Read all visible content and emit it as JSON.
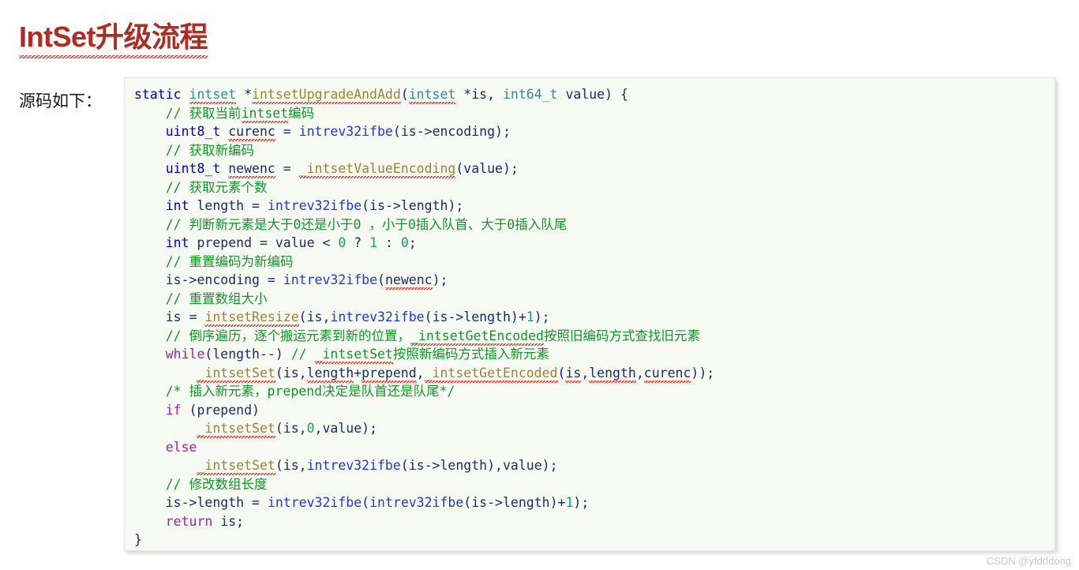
{
  "page": {
    "title": "IntSet升级流程",
    "source_label": "源码如下：",
    "watermark": "CSDN @yfdddong",
    "title_color": "#b02b22",
    "code_background": "#f7faf2",
    "spellcheck_underline_color": "#e03b30"
  },
  "code": {
    "language": "c",
    "lines": [
      "static intset *intsetUpgradeAndAdd(intset *is, int64_t value) {",
      "    // 获取当前intset编码",
      "    uint8_t curenc = intrev32ifbe(is->encoding);",
      "    // 获取新编码",
      "    uint8_t newenc = _intsetValueEncoding(value);",
      "    // 获取元素个数",
      "    int length = intrev32ifbe(is->length);",
      "    // 判断新元素是大于0还是小于0 ，小于0插入队首、大于0插入队尾",
      "    int prepend = value < 0 ? 1 : 0;",
      "    // 重置编码为新编码",
      "    is->encoding = intrev32ifbe(newenc);",
      "    // 重置数组大小",
      "    is = intsetResize(is,intrev32ifbe(is->length)+1);",
      "    // 倒序遍历，逐个搬运元素到新的位置，_intsetGetEncoded按照旧编码方式查找旧元素",
      "    while(length--) // _intsetSet按照新编码方式插入新元素",
      "        _intsetSet(is,length+prepend,_intsetGetEncoded(is,length,curenc));",
      "    /* 插入新元素，prepend决定是队首还是队尾*/",
      "    if (prepend)",
      "        _intsetSet(is,0,value);",
      "    else",
      "        _intsetSet(is,intrev32ifbe(is->length),value);",
      "    // 修改数组长度",
      "    is->length = intrev32ifbe(intrev32ifbe(is->length)+1);",
      "    return is;",
      "}"
    ],
    "token_colors": {
      "keyword": "#0000cd",
      "control_keyword": "#a020b0",
      "type": "#2a8b9e",
      "function": "#9a8434",
      "identifier": "#1b2a6b",
      "number": "#1a9c6e",
      "comment": "#13952b",
      "call": "#2337cf"
    }
  }
}
